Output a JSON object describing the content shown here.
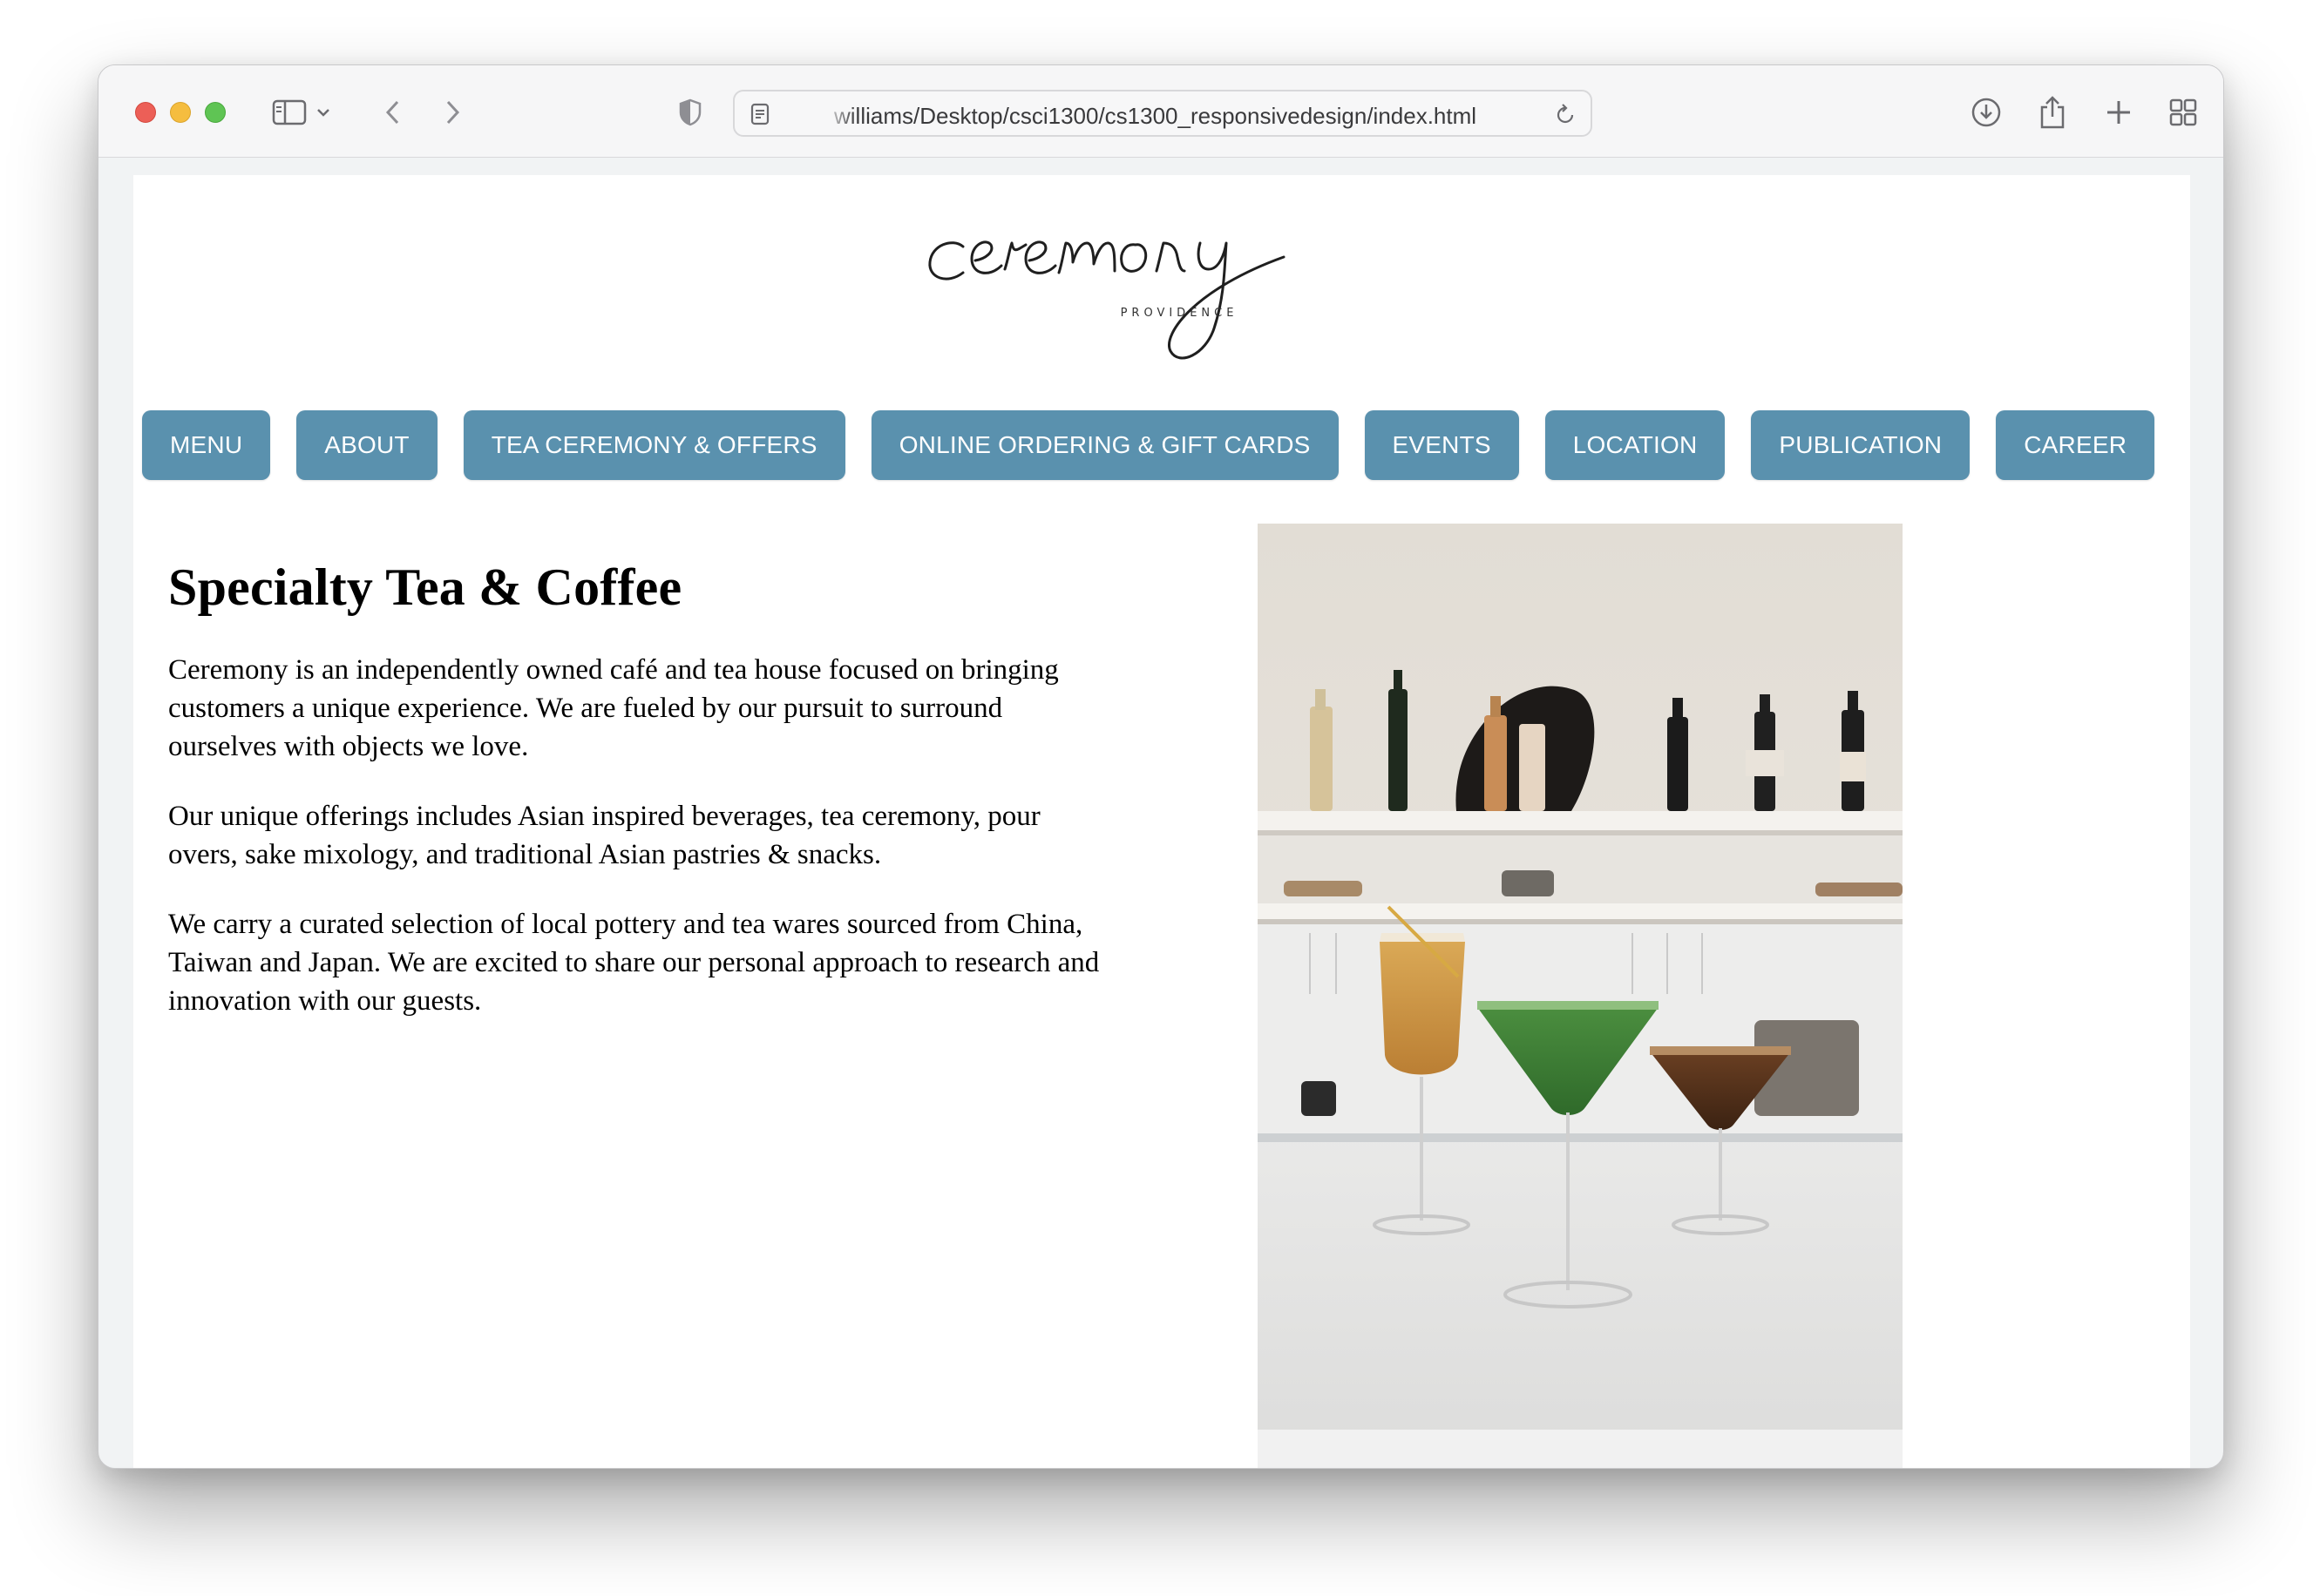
{
  "browser": {
    "url": "williams/Desktop/csci1300/cs1300_responsivedesign/index.html"
  },
  "logo": {
    "wordmark": "ceremony",
    "sub": "PROVIDENCE"
  },
  "nav": {
    "items": [
      {
        "label": "MENU"
      },
      {
        "label": "ABOUT"
      },
      {
        "label": "TEA CEREMONY & OFFERS"
      },
      {
        "label": "ONLINE ORDERING & GIFT CARDS"
      },
      {
        "label": "EVENTS"
      },
      {
        "label": "LOCATION"
      },
      {
        "label": "PUBLICATION"
      },
      {
        "label": "CAREER"
      }
    ],
    "color": "#5a91ae"
  },
  "main": {
    "heading": "Specialty Tea & Coffee",
    "paragraphs": [
      "Ceremony is an independently owned café and tea house focused on bringing customers a unique experience. We are fueled by our pursuit to surround ourselves with objects we love.",
      "Our unique offerings includes Asian inspired beverages, tea ceremony, pour overs, sake mixology, and traditional Asian pastries & snacks.",
      "We carry a curated selection of local pottery and tea wares sourced from China, Taiwan and Japan. We are excited to share our personal approach to research and innovation with our guests."
    ]
  }
}
